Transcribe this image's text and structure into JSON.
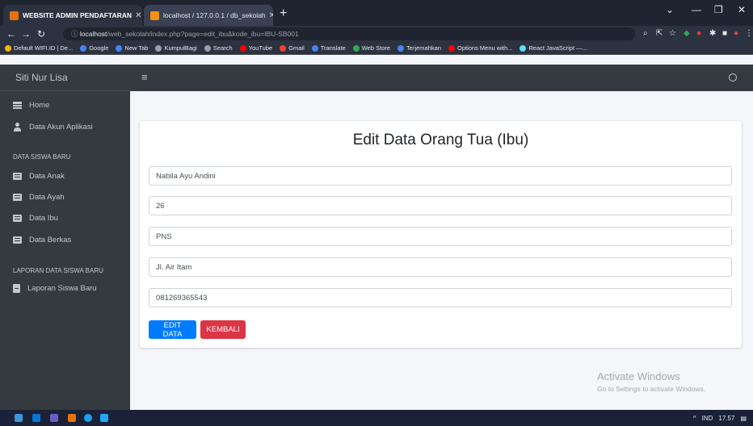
{
  "browser": {
    "tabs": [
      {
        "title": "WEBSITE ADMIN PENDAFTARAN",
        "active": true,
        "favicon_color": "#e8710a"
      },
      {
        "title": "localhost / 127.0.0.1 / db_sekolah",
        "active": false,
        "favicon_color": "#f29111"
      }
    ],
    "new_tab_symbol": "+",
    "url_host": "localhost",
    "url_path": "/web_sekolah/index.php?page=edit_ibu&kode_ibu=IBU-SB001",
    "bookmarks": [
      {
        "label": "Default WIFI.ID | De...",
        "icon_color": "#f4b400"
      },
      {
        "label": "Google",
        "icon_color": "#4285f4"
      },
      {
        "label": "New Tab",
        "icon_color": "#4285f4"
      },
      {
        "label": "KumpulBagi",
        "icon_color": "#9aa0a6"
      },
      {
        "label": "Search",
        "icon_color": "#9aa0a6"
      },
      {
        "label": "YouTube",
        "icon_color": "#ff0000"
      },
      {
        "label": "Gmail",
        "icon_color": "#ea4335"
      },
      {
        "label": "Translate",
        "icon_color": "#4285f4"
      },
      {
        "label": "Web Store",
        "icon_color": "#34a853"
      },
      {
        "label": "Terjemahkan",
        "icon_color": "#4285f4"
      },
      {
        "label": "Options Menu with...",
        "icon_color": "#ff0000"
      },
      {
        "label": "React JavaScript —...",
        "icon_color": "#61dafb"
      }
    ]
  },
  "sidebar": {
    "brand": "Siti Nur Lisa",
    "items": [
      {
        "label": "Home",
        "icon": "home-icon"
      },
      {
        "label": "Data Akun Aplikasi",
        "icon": "user-icon"
      }
    ],
    "section1_header": "DATA SISWA BARU",
    "section1_items": [
      {
        "label": "Data Anak",
        "icon": "table-icon"
      },
      {
        "label": "Data Ayah",
        "icon": "table-icon"
      },
      {
        "label": "Data Ibu",
        "icon": "table-icon"
      },
      {
        "label": "Data Berkas",
        "icon": "table-icon"
      }
    ],
    "section2_header": "LAPORAN DATA SISWA BARU",
    "section2_items": [
      {
        "label": "Laporan Siswa Baru",
        "icon": "report-icon"
      }
    ]
  },
  "form": {
    "title": "Edit Data Orang Tua (Ibu)",
    "fields": {
      "nama": "Nabila Ayu Andini",
      "umur": "26",
      "pekerjaan": "PNS",
      "alamat": "Jl. Air Itam",
      "telepon": "081269365543"
    },
    "edit_button": "EDIT DATA",
    "back_button": "KEMBALI"
  },
  "watermark": {
    "line1": "Activate Windows",
    "line2": "Go to Settings to activate Windows."
  },
  "taskbar": {
    "language": "IND",
    "time": "17.57"
  }
}
